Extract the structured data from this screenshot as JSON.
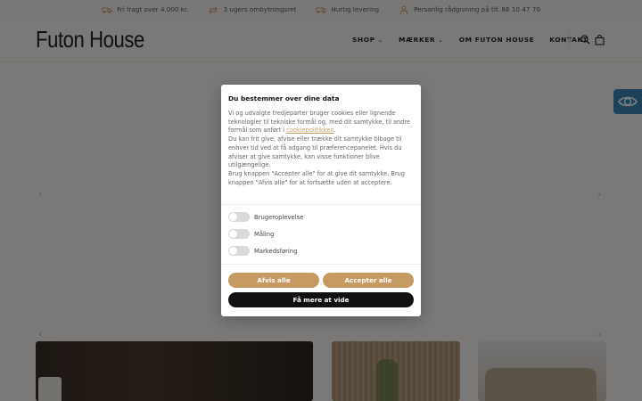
{
  "topbar": {
    "usps": [
      {
        "icon": "truck-icon",
        "text": "Fri fragt over 4.000 kr."
      },
      {
        "icon": "return-arrows-icon",
        "text": "3 ugers ombytningsret"
      },
      {
        "icon": "delivery-van-icon",
        "text": "Hurtig levering"
      },
      {
        "icon": "person-icon",
        "text": "Personlig rådgivning på tlf. 86 10 47 70"
      }
    ]
  },
  "header": {
    "logo": "Futon House",
    "nav": [
      {
        "label": "SHOP",
        "chevron": "⌄"
      },
      {
        "label": "MÆRKER",
        "chevron": "⌄"
      },
      {
        "label": "OM FUTON HOUSE"
      },
      {
        "label": "KONTAKT"
      }
    ]
  },
  "hero": {
    "arrow_left": "‹",
    "arrow_right": "›"
  },
  "cookie": {
    "title": "Du bestemmer over dine data",
    "p1_a": "Vi og udvalgte tredjeparter bruger cookies eller lignende teknologier til tekniske formål og, med dit samtykke, til andre formål som anført i ",
    "p1_link": "cookiepolitikken",
    "p1_b": ".",
    "p2": "Du kan frit give, afvise eller trække dit samtykke tilbage til enhver tid ved at få adgang til præferencepanelet. Hvis du afviser at give samtykke, kan visse funktioner blive utilgængelige.",
    "p3": "Brug knappen \"Accepter alle\" for at give dit samtykke. Brug knappen \"Afvis alle\" for at fortsætte uden at acceptere.",
    "toggles": [
      {
        "label": "Brugeroplevelse",
        "on": false
      },
      {
        "label": "Måling",
        "on": false
      },
      {
        "label": "Markedsføring",
        "on": false
      }
    ],
    "reject_label": "Afvis alle",
    "accept_label": "Accepter alle",
    "more_label": "Få mere at vide"
  },
  "colors": {
    "accent": "#c69b63",
    "dark": "#111111",
    "accessibility": "#3a86b8"
  }
}
